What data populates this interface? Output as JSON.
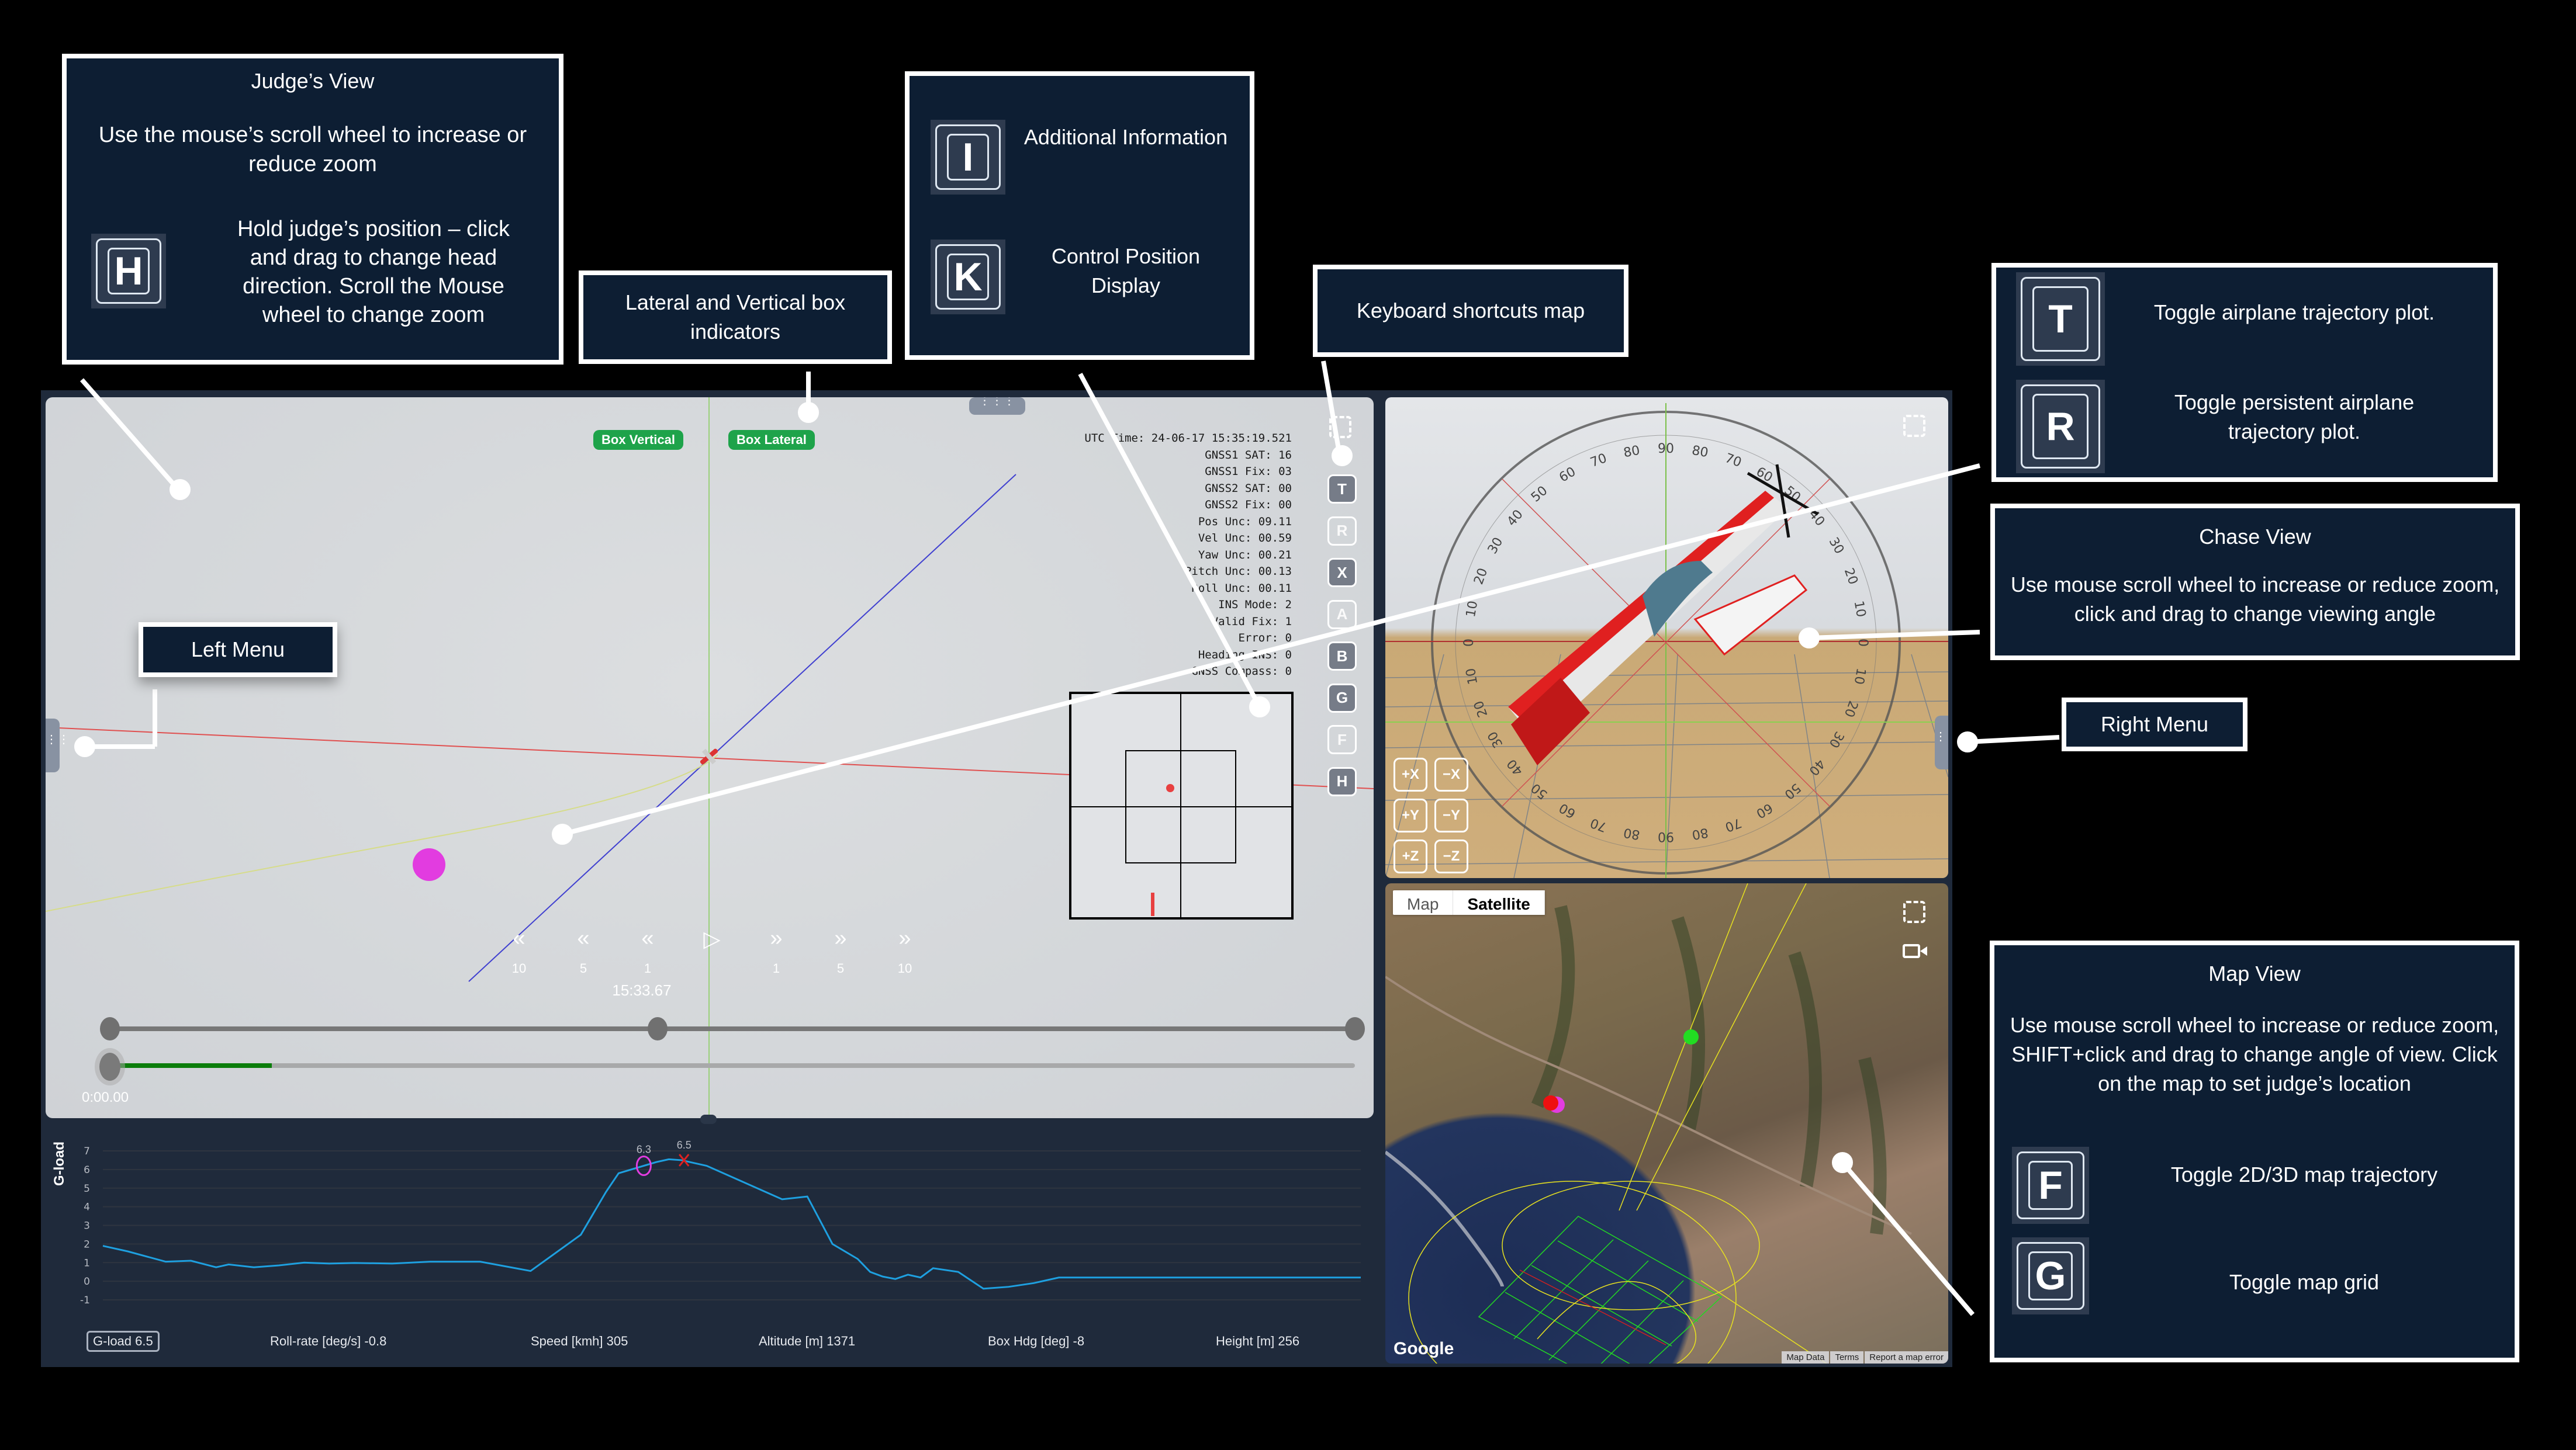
{
  "judges_view": {
    "badges": {
      "box_vertical": "Box Vertical",
      "box_lateral": "Box Lateral"
    },
    "info": [
      "UTC Time: 24-06-17 15:35:19.521",
      "GNSS1 SAT: 16",
      "GNSS1 Fix: 03",
      "GNSS2 SAT: 00",
      "GNSS2 Fix: 00",
      "Pos Unc: 09.11",
      "Vel Unc: 00.59",
      "Yaw Unc: 00.21",
      "Pitch Unc: 00.13",
      "Roll Unc: 00.11",
      "INS Mode: 2",
      "Valid Fix: 1",
      "Error: 0",
      "Heading INS: 0",
      "GNSS Compass: 0"
    ],
    "shortcuts": [
      {
        "key": "T",
        "active": true
      },
      {
        "key": "R",
        "active": false
      },
      {
        "key": "X",
        "active": true
      },
      {
        "key": "A",
        "active": false
      },
      {
        "key": "B",
        "active": true
      },
      {
        "key": "G",
        "active": true
      },
      {
        "key": "F",
        "active": false
      },
      {
        "key": "H",
        "active": true
      }
    ],
    "playback": {
      "buttons": [
        {
          "name": "rewind-10",
          "glyph": "«",
          "label": "10"
        },
        {
          "name": "rewind-5",
          "glyph": "«",
          "label": "5"
        },
        {
          "name": "rewind-1",
          "glyph": "«",
          "label": "1"
        },
        {
          "name": "play",
          "glyph": "▷",
          "label": ""
        },
        {
          "name": "forward-1",
          "glyph": "»",
          "label": "1"
        },
        {
          "name": "forward-5",
          "glyph": "»",
          "label": "5"
        },
        {
          "name": "forward-10",
          "glyph": "»",
          "label": "10"
        }
      ],
      "current_time": "15:33.67",
      "elapsed": "0:00.00",
      "range_slider_positions": [
        0.0,
        0.44,
        1.0
      ],
      "progress": 0.13
    }
  },
  "chase_view": {
    "axis_buttons": [
      "+X",
      "−X",
      "+Y",
      "−Y",
      "+Z",
      "−Z"
    ],
    "protractor_labels": [
      "90",
      "80",
      "70",
      "60",
      "50",
      "40",
      "30",
      "20",
      "10",
      "0"
    ]
  },
  "map_view": {
    "map_type_options": [
      "Map",
      "Satellite"
    ],
    "selected_map_type": "Satellite",
    "logo": "Google",
    "footer_links": [
      "Map Data",
      "Terms",
      "Report a map error"
    ]
  },
  "stats_bar": {
    "items": [
      {
        "label": "G-load 6.5",
        "selected": true
      },
      {
        "label": "Roll-rate [deg/s] -0.8",
        "selected": false
      },
      {
        "label": "Speed [kmh] 305",
        "selected": false
      },
      {
        "label": "Altitude [m] 1371",
        "selected": false
      },
      {
        "label": "Box Hdg [deg] -8",
        "selected": false
      },
      {
        "label": "Height [m] 256",
        "selected": false
      }
    ]
  },
  "chart_data": {
    "type": "line",
    "title": "",
    "xlabel": "",
    "ylabel": "G-load",
    "ylim": [
      -1,
      7
    ],
    "yticks": [
      -1,
      0,
      1,
      2,
      3,
      4,
      5,
      6,
      7
    ],
    "grid": true,
    "series": [
      {
        "name": "G-load",
        "color": "#1ea0e0",
        "x": [
          0,
          0.02,
          0.05,
          0.07,
          0.09,
          0.1,
          0.12,
          0.14,
          0.16,
          0.18,
          0.2,
          0.23,
          0.26,
          0.3,
          0.34,
          0.38,
          0.4,
          0.41,
          0.42,
          0.43,
          0.44,
          0.45,
          0.46,
          0.48,
          0.5,
          0.52,
          0.54,
          0.56,
          0.58,
          0.6,
          0.61,
          0.62,
          0.63,
          0.64,
          0.65,
          0.66,
          0.68,
          0.7,
          0.72,
          0.74,
          0.76,
          0.78,
          0.8,
          0.82,
          0.84,
          0.86,
          0.88,
          0.9,
          0.92,
          0.94,
          0.96,
          0.98,
          1.0
        ],
        "values": [
          1.9,
          1.6,
          1.05,
          1.1,
          0.75,
          0.9,
          0.75,
          0.85,
          1.0,
          0.95,
          0.98,
          0.95,
          1.05,
          1.05,
          0.55,
          2.5,
          4.8,
          5.8,
          6.0,
          6.2,
          6.4,
          6.55,
          6.5,
          6.2,
          5.6,
          5.0,
          4.4,
          4.55,
          2.0,
          1.2,
          0.5,
          0.25,
          0.12,
          0.35,
          0.2,
          0.7,
          0.5,
          -0.4,
          -0.3,
          -0.1,
          0.2,
          0.2,
          0.2,
          0.2,
          0.2,
          0.2,
          0.2,
          0.2,
          0.2,
          0.2,
          0.2,
          0.2,
          0.2
        ]
      }
    ],
    "annotations": [
      {
        "type": "circle",
        "color": "#e23ce0",
        "label": "6.3"
      },
      {
        "type": "cross",
        "color": "#e02020",
        "label": "6.5"
      }
    ]
  },
  "annotations": {
    "judges_view": {
      "title": "Judge’s View",
      "text1": "Use the mouse’s scroll wheel to increase or reduce zoom",
      "key": "H",
      "text2": "Hold judge’s position – click and drag to change head direction. Scroll the Mouse wheel  to change zoom"
    },
    "box_indicators": "Lateral and Vertical box indicators",
    "additional_info": {
      "key": "I",
      "text": "Additional Information"
    },
    "control_position": {
      "key": "K",
      "text": "Control Position Display"
    },
    "keyboard_map": "Keyboard  shortcuts map",
    "left_menu": "Left Menu",
    "trajectory": {
      "t_key": "T",
      "t_text": "Toggle airplane trajectory plot.",
      "r_key": "R",
      "r_text": "Toggle persistent airplane trajectory plot."
    },
    "chase_view": {
      "title": "Chase View",
      "text": "Use mouse scroll wheel to increase or reduce zoom, click and drag to change viewing angle"
    },
    "right_menu": "Right Menu",
    "map_view": {
      "title": "Map View",
      "text": "Use mouse scroll wheel to increase or reduce zoom, SHIFT+click and drag to change angle of view. Click on the map to set judge’s location",
      "f_key": "F",
      "f_text": "Toggle 2D/3D map trajectory",
      "g_key": "G",
      "g_text": "Toggle map grid"
    }
  }
}
